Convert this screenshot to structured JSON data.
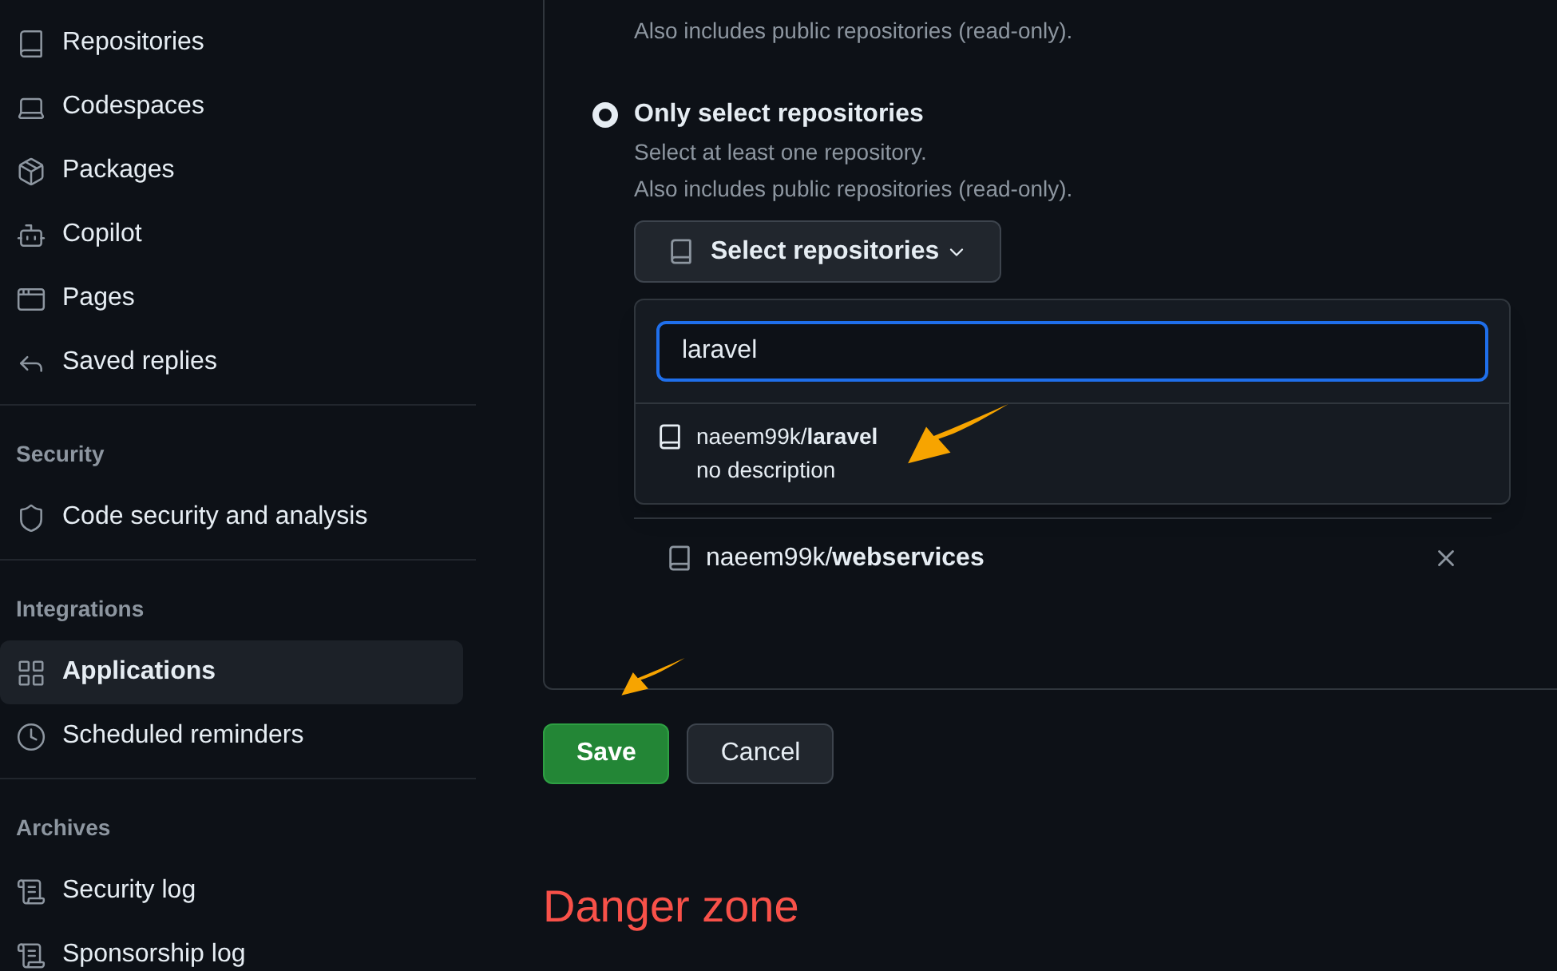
{
  "sidebar": {
    "sections": [
      {
        "items": [
          {
            "label": "Repositories",
            "selected": false
          },
          {
            "label": "Codespaces",
            "selected": false
          },
          {
            "label": "Packages",
            "selected": false
          },
          {
            "label": "Copilot",
            "selected": false
          },
          {
            "label": "Pages",
            "selected": false
          },
          {
            "label": "Saved replies",
            "selected": false
          }
        ]
      },
      {
        "heading": "Security",
        "items": [
          {
            "label": "Code security and analysis",
            "selected": false
          }
        ]
      },
      {
        "heading": "Integrations",
        "items": [
          {
            "label": "Applications",
            "selected": true
          },
          {
            "label": "Scheduled reminders",
            "selected": false
          }
        ]
      },
      {
        "heading": "Archives",
        "items": [
          {
            "label": "Security log",
            "selected": false
          },
          {
            "label": "Sponsorship log",
            "selected": false
          }
        ]
      }
    ]
  },
  "main": {
    "previous_note": "Also includes public repositories (read-only).",
    "option": {
      "label": "Only select repositories",
      "selected": true,
      "description": [
        "Select at least one repository.",
        "Also includes public repositories (read-only)."
      ]
    },
    "select_button": "Select repositories",
    "dropdown": {
      "search_value": "laravel",
      "results": [
        {
          "owner": "naeem99k/",
          "name": "laravel",
          "description": "no description"
        }
      ]
    },
    "selected_repos": [
      {
        "owner": "naeem99k/",
        "name": "webservices"
      }
    ],
    "buttons": [
      {
        "label": "Save",
        "kind": "primary"
      },
      {
        "label": "Cancel",
        "kind": "secondary"
      }
    ],
    "danger_zone": "Danger zone"
  }
}
